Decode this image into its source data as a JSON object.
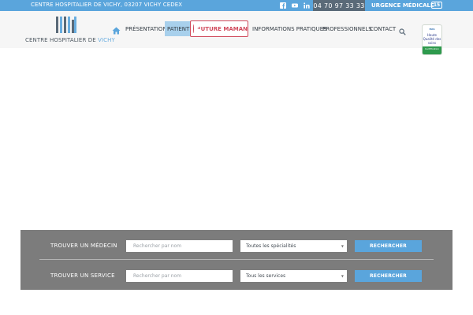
{
  "topbar": {
    "address": "CENTRE HOSPITALIER DE VICHY, 03207 VICHY CEDEX",
    "social": [
      "facebook-icon",
      "youtube-icon",
      "linkedin-icon"
    ],
    "phone": "04 70 97 33 33",
    "urgence": "URGENCE MÉDICALE",
    "samu": "15"
  },
  "logo": {
    "text_main": "CENTRE HOSPITALIER DE",
    "text_accent": "VICHY",
    "colors": [
      "#5a6a78",
      "#6aaee0",
      "#5a6a78",
      "#6aaee0",
      "#5a6a78",
      "#6aaee0"
    ]
  },
  "nav": {
    "home_icon": "home-icon",
    "items": [
      "PRÉSENTATION",
      "PATIENT",
      "INFORMATIONS PRATIQUES",
      "PROFESSIONNELS",
      "CONTACT"
    ],
    "future": "FUTURE MAMAN",
    "search_icon": "search-icon"
  },
  "badge": {
    "org": "HAS",
    "text": "Haute Qualité des soins",
    "footer": "Certification"
  },
  "search": {
    "medecin": {
      "title": "TROUVER UN MÉDECIN",
      "placeholder": "Rechercher par nom",
      "select": "Toutes les spécialités",
      "button": "RECHERCHER"
    },
    "service": {
      "title": "TROUVER UN SERVICE",
      "placeholder": "Rechercher par nom",
      "select": "Tous les services",
      "button": "RECHERCHER"
    }
  },
  "colors": {
    "accent": "#5aa5dc",
    "phone_bg": "#5a6a78",
    "future": "#d04a5c",
    "panel": "#7c7c7c"
  }
}
